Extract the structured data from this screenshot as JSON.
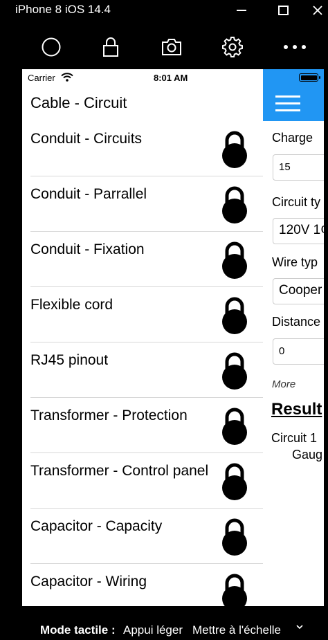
{
  "window": {
    "title": "iPhone 8 iOS 14.4"
  },
  "toolbar": {
    "icons": [
      "home-circle-icon",
      "lock-icon",
      "camera-icon",
      "gear-icon",
      "more-icon"
    ]
  },
  "device": {
    "status": {
      "carrier": "Carrier",
      "time": "8:01 AM"
    },
    "nav_title": "Cable - Circuit",
    "list": [
      {
        "label": "Conduit - Circuits"
      },
      {
        "label": "Conduit - Parrallel"
      },
      {
        "label": "Conduit - Fixation"
      },
      {
        "label": "Flexible cord"
      },
      {
        "label": "RJ45 pinout"
      },
      {
        "label": "Transformer - Protection"
      },
      {
        "label": "Transformer - Control panel"
      },
      {
        "label": "Capacitor - Capacity"
      },
      {
        "label": "Capacitor - Wiring"
      }
    ],
    "panel": {
      "charge_label": "Charge",
      "charge_value": "15",
      "circuit_type_label": "Circuit ty",
      "circuit_type_value": "120V 1¢",
      "wire_type_label": "Wire typ",
      "wire_type_value": "Cooper",
      "distance_label": "Distance",
      "distance_value": "0",
      "more": "More",
      "result_title": "Result",
      "result_line1": "Circuit 1",
      "result_line2": "Gaug"
    }
  },
  "bottom": {
    "mode_label": "Mode tactile :",
    "option_a": "Appui léger",
    "option_b": "Mettre à l'échelle"
  },
  "colors": {
    "accent": "#2196f3"
  }
}
